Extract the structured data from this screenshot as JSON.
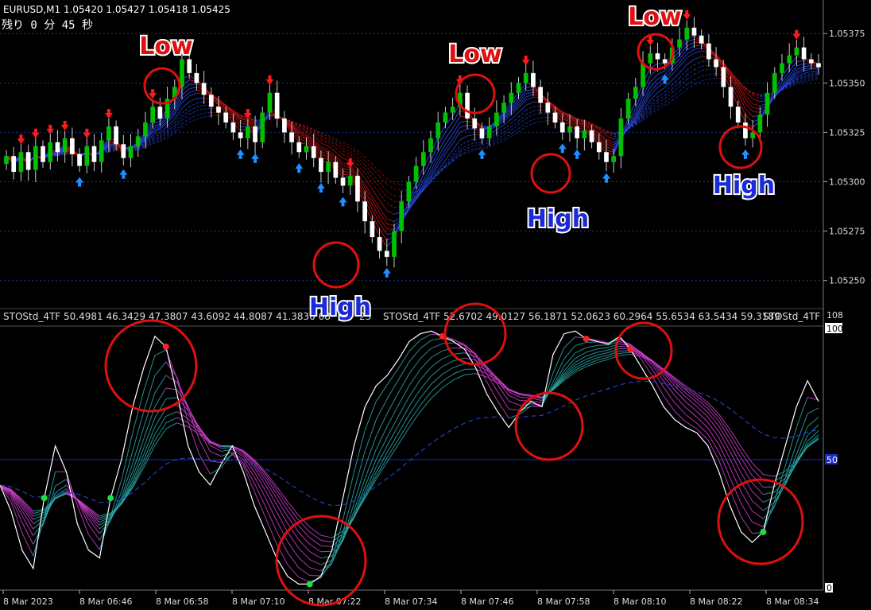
{
  "header": {
    "symbol_line": "EURUSD,M1  1.05420 1.05427 1.05418 1.05425",
    "timer": "残り 0 分 45 秒"
  },
  "indicator": {
    "label_1": "STOStd_4TF 50.4981 46.3429 47.3807 43.6092 44.8087 41.3830 68",
    "label_1_tail": "23",
    "label_2": "STOStd_4TF 52.6702 49.0127 56.1871 52.0623 60.2964 55.6534 63.5434 59.3189",
    "label_3": "STOStd_4TF",
    "scale_max": "108",
    "level_top": "100",
    "level_mid": "50",
    "level_bottom": "0"
  },
  "annotations": [
    {
      "text": "Low",
      "kind": "low"
    },
    {
      "text": "Low",
      "kind": "low"
    },
    {
      "text": "Low",
      "kind": "low"
    },
    {
      "text": "High",
      "kind": "high"
    },
    {
      "text": "High",
      "kind": "high"
    },
    {
      "text": "High",
      "kind": "high"
    }
  ],
  "colors": {
    "background": "#000000",
    "bull_candle": "#00c000",
    "bear_candle": "#ffffff",
    "ma_red": "#b41414",
    "ma_blue": "#2848e0",
    "arrow_up": "#1e90ff",
    "arrow_down": "#ff1a1a",
    "circle": "#e01010",
    "low_text": "#e01010",
    "high_text": "#1a2ad8",
    "osc_magenta": "#d040d0",
    "osc_teal": "#2ca8a8",
    "mid_line": "#1a2acc",
    "grid": "#1a3a8a"
  },
  "chart_data": [
    {
      "type": "candlestick",
      "title": "EURUSD,M1",
      "y_ticks": [
        "1.05375",
        "1.05350",
        "1.05325",
        "1.05300",
        "1.05275",
        "1.05250"
      ],
      "ylim": [
        1.05237,
        1.05392
      ],
      "grid": true,
      "series": [
        {
          "name": "",
          "values": [
            1.05313,
            1.05305,
            1.05315,
            1.05306,
            1.05318,
            1.0531,
            1.0532,
            1.05315,
            1.05322,
            1.05314,
            1.05308,
            1.05318,
            1.0531,
            1.05321,
            1.05328,
            1.05319,
            1.05312,
            1.05318,
            1.05323,
            1.0533,
            1.05338,
            1.05332,
            1.05342,
            1.05348,
            1.05362,
            1.05355,
            1.0535,
            1.05344,
            1.05338,
            1.05335,
            1.0533,
            1.05325,
            1.05322,
            1.05328,
            1.0532,
            1.05335,
            1.05345,
            1.05332,
            1.05325,
            1.0532,
            1.05315,
            1.05318,
            1.05312,
            1.05305,
            1.0531,
            1.05302,
            1.05298,
            1.05303,
            1.0529,
            1.0528,
            1.05272,
            1.05265,
            1.05262,
            1.05275,
            1.0529,
            1.053,
            1.05308,
            1.05315,
            1.05322,
            1.0533,
            1.05335,
            1.05338,
            1.05345,
            1.05332,
            1.05327,
            1.05322,
            1.05328,
            1.05335,
            1.0534,
            1.05345,
            1.0535,
            1.05355,
            1.05348,
            1.0534,
            1.05335,
            1.0533,
            1.05325,
            1.05328,
            1.05322,
            1.05326,
            1.0532,
            1.05315,
            1.0531,
            1.05313,
            1.05332,
            1.05342,
            1.05348,
            1.0536,
            1.05365,
            1.05362,
            1.0536,
            1.05368,
            1.05372,
            1.05378,
            1.05374,
            1.0537,
            1.05362,
            1.05358,
            1.05348,
            1.05338,
            1.0533,
            1.05322,
            1.05325,
            1.05334,
            1.05345,
            1.05355,
            1.0536,
            1.05364,
            1.05368,
            1.05362,
            1.0536,
            1.05358
          ]
        }
      ]
    },
    {
      "type": "line",
      "title": "STOStd_4TF",
      "x_tick_labels": [
        "8 Mar 2023",
        "8 Mar 06:46",
        "8 Mar 06:58",
        "8 Mar 07:10",
        "8 Mar 07:22",
        "8 Mar 07:34",
        "8 Mar 07:46",
        "8 Mar 07:58",
        "8 Mar 08:10",
        "8 Mar 08:22",
        "8 Mar 08:34"
      ],
      "ylim": [
        0,
        108
      ],
      "levels": [
        0,
        50,
        100
      ],
      "grid": false,
      "series": [
        {
          "name": "",
          "values": [
            40,
            30,
            15,
            8,
            35,
            55,
            45,
            25,
            15,
            12,
            35,
            50,
            70,
            85,
            97,
            93,
            75,
            55,
            45,
            40,
            48,
            55,
            45,
            32,
            22,
            12,
            5,
            2,
            2,
            5,
            15,
            35,
            55,
            70,
            78,
            82,
            88,
            95,
            98,
            99,
            97,
            95,
            92,
            85,
            75,
            68,
            62,
            68,
            72,
            70,
            90,
            98,
            99,
            96,
            95,
            94,
            97,
            92,
            85,
            78,
            70,
            65,
            62,
            60,
            55,
            45,
            32,
            22,
            18,
            22,
            40,
            55,
            70,
            80,
            72
          ]
        }
      ]
    }
  ]
}
